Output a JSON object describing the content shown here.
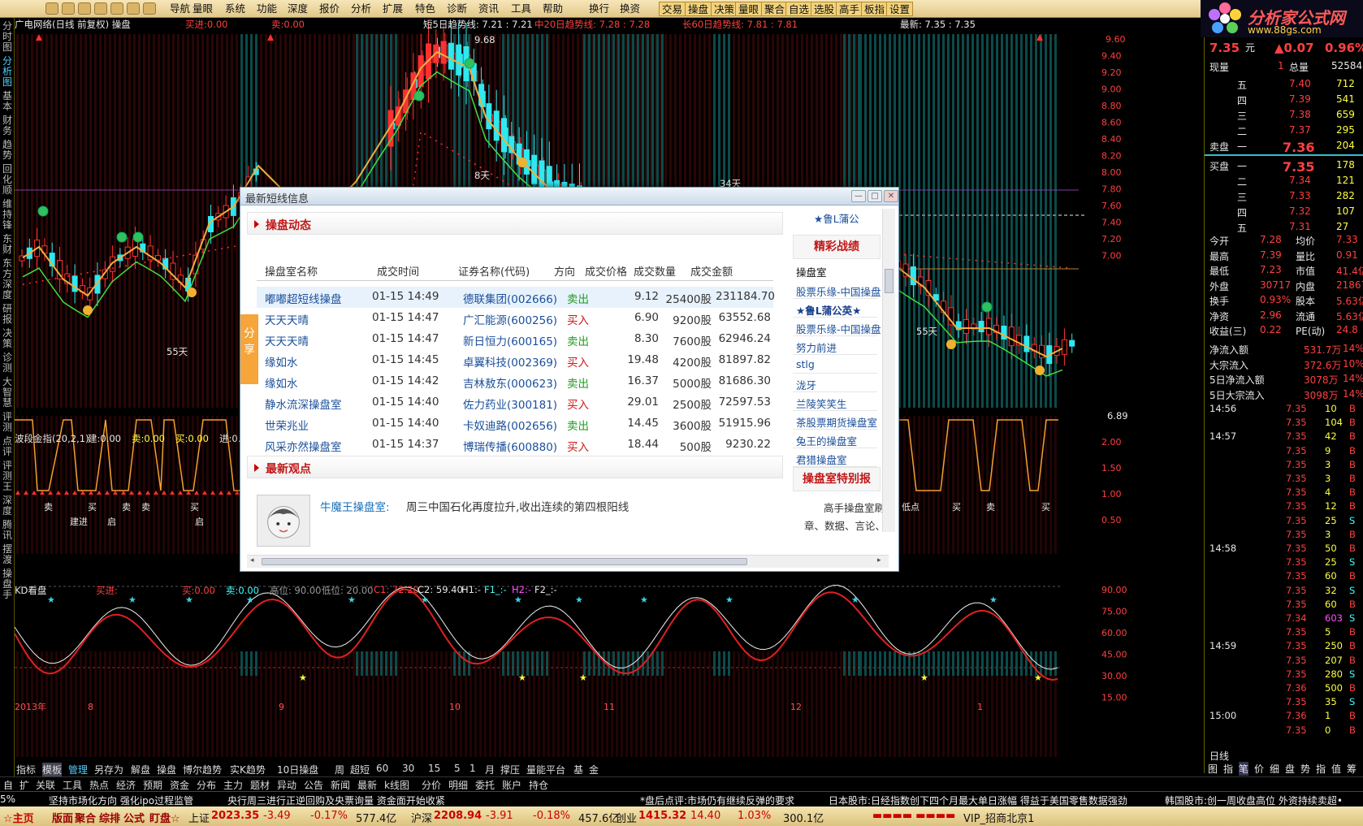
{
  "menu": [
    "导航",
    "量眼",
    "系统",
    "功能",
    "深度",
    "报价",
    "分析",
    "扩展",
    "特色",
    "诊断",
    "资讯",
    "工具",
    "帮助",
    "换行",
    "换资",
    "交易",
    "操盘",
    "决策",
    "量眼",
    "聚合",
    "自选",
    "选股",
    "高手",
    "板指",
    "设置"
  ],
  "logo": {
    "title": "分析家公式网",
    "url": "www.88gs.com"
  },
  "left_tabs": [
    "分时图",
    "分析图",
    "基本",
    "财务",
    "趋势",
    "回化顺",
    "维持锋",
    "东财",
    "东方深度",
    "研报",
    "决策",
    "诊测",
    "大智慧",
    "评测",
    "点评",
    "评测王",
    "深度",
    "腾讯",
    "摆渡",
    "操盘手"
  ],
  "chart_header": {
    "title": "广电网络(日线 前复权) 操盘",
    "buy": "买进:0.00",
    "sell": "卖:0.00",
    "ma5": "短5日趋势线: 7.21 : 7.21",
    "ma20": "中20日趋势线: 7.28 : 7.28",
    "ma60": "长60日趋势线: 7.81 : 7.81",
    "latest": "最新: 7.35 : 7.35"
  },
  "main_labels": {
    "peak": "9.68",
    "d8": "8天",
    "d34": "34天",
    "d55a": "55天",
    "d55b": "55天",
    "low": "6.89"
  },
  "price_axis": [
    "9.60",
    "9.40",
    "9.20",
    "9.00",
    "8.80",
    "8.60",
    "8.40",
    "8.20",
    "8.00",
    "7.80",
    "7.60",
    "7.40",
    "7.20",
    "7.00"
  ],
  "ind1_header": {
    "name": "波段金指(20,2,1)",
    "jian": "建:0.00",
    "mai": "卖:0.00",
    "buy": "买:0.00",
    "jin": "进:0."
  },
  "ind1_axis": [
    "2.00",
    "1.50",
    "1.00",
    "0.50"
  ],
  "ind1_labels": [
    {
      "t": "卖"
    },
    {
      "t": "建进"
    },
    {
      "t": "买"
    },
    {
      "t": "启"
    },
    {
      "t": "卖"
    },
    {
      "t": "卖"
    },
    {
      "t": "买"
    },
    {
      "t": "启"
    },
    {
      "t": "卖"
    },
    {
      "t": "低点"
    },
    {
      "t": "买"
    },
    {
      "t": "卖"
    },
    {
      "t": "买"
    }
  ],
  "ind2_header": {
    "name": "KD看盘",
    "mai": "买进:",
    "buy": "买:0.00",
    "sell": "卖:0.00",
    "gao": "高位: 90.00",
    "di": "低位: 20.00",
    "c1": "C1: 72.20",
    "c2": "C2: 59.40",
    "h1": "H1:-",
    "f1": "F1_:-",
    "h2": "H2:-",
    "f2": "F2_:-"
  },
  "ind2_axis": [
    "90.00",
    "75.00",
    "60.00",
    "45.00",
    "30.00",
    "15.00"
  ],
  "x_axis": [
    "2013年",
    "8",
    "9",
    "10",
    "11",
    "12",
    "1"
  ],
  "quote": {
    "price": "7.35",
    "unit": "元",
    "change": "▲0.07",
    "pct": "0.96%",
    "xianshou_l": "现量",
    "xianshou": "1",
    "zongliang_l": "总量",
    "zongliang": "52584",
    "sells": [
      [
        "五",
        "7.40",
        "712"
      ],
      [
        "四",
        "7.39",
        "541"
      ],
      [
        "三",
        "7.38",
        "659"
      ],
      [
        "二",
        "7.37",
        "295"
      ],
      [
        "一",
        "7.36",
        "204"
      ]
    ],
    "sell_label": "卖盘",
    "buy_label": "买盘",
    "buys": [
      [
        "一",
        "7.35",
        "178"
      ],
      [
        "二",
        "7.34",
        "121"
      ],
      [
        "三",
        "7.33",
        "282"
      ],
      [
        "四",
        "7.32",
        "107"
      ],
      [
        "五",
        "7.31",
        "27"
      ]
    ],
    "stats": [
      [
        "今开",
        "7.28",
        "均价",
        "7.33"
      ],
      [
        "最高",
        "7.39",
        "量比",
        "0.91"
      ],
      [
        "最低",
        "7.23",
        "市值",
        "41.4亿"
      ],
      [
        "外盘",
        "30717",
        "内盘",
        "21867"
      ],
      [
        "换手",
        "0.93%",
        "股本",
        "5.63亿"
      ],
      [
        "净资",
        "2.96",
        "流通",
        "5.63亿"
      ],
      [
        "收益(三)",
        "0.22",
        "PE(动)",
        "24.8"
      ]
    ],
    "flows": [
      [
        "净流入额",
        "531.7万",
        "14%"
      ],
      [
        "大宗流入",
        "372.6万",
        "10%"
      ],
      [
        "5日净流入额",
        "3078万",
        "14%"
      ],
      [
        "5日大宗流入",
        "3098万",
        "14%"
      ]
    ]
  },
  "ticks": [
    [
      "14:56",
      "7.35",
      "10",
      "B"
    ],
    [
      "",
      "7.35",
      "104",
      "B"
    ],
    [
      "14:57",
      "7.35",
      "42",
      "B"
    ],
    [
      "",
      "7.35",
      "9",
      "B"
    ],
    [
      "",
      "7.35",
      "3",
      "B"
    ],
    [
      "",
      "7.35",
      "3",
      "B"
    ],
    [
      "",
      "7.35",
      "4",
      "B"
    ],
    [
      "",
      "7.35",
      "12",
      "B"
    ],
    [
      "",
      "7.35",
      "25",
      "S"
    ],
    [
      "",
      "7.35",
      "3",
      "B"
    ],
    [
      "14:58",
      "7.35",
      "50",
      "B"
    ],
    [
      "",
      "7.35",
      "25",
      "S"
    ],
    [
      "",
      "7.35",
      "60",
      "B"
    ],
    [
      "",
      "7.35",
      "32",
      "S"
    ],
    [
      "",
      "7.35",
      "60",
      "B"
    ],
    [
      "",
      "7.34",
      "603",
      "S"
    ],
    [
      "",
      "7.35",
      "5",
      "B"
    ],
    [
      "14:59",
      "7.35",
      "250",
      "B"
    ],
    [
      "",
      "7.35",
      "207",
      "B"
    ],
    [
      "",
      "7.35",
      "280",
      "S"
    ],
    [
      "",
      "7.36",
      "500",
      "B"
    ],
    [
      "",
      "7.35",
      "35",
      "S"
    ],
    [
      "15:00",
      "7.36",
      "1",
      "B"
    ],
    [
      "",
      "7.35",
      "0",
      "B"
    ]
  ],
  "right_bottom": {
    "rixian": "日线",
    "tabs": [
      "图",
      "指",
      "笔",
      "价",
      "细",
      "盘",
      "势",
      "指",
      "值",
      "筹"
    ]
  },
  "bottom_tabs1": [
    "指标",
    "模板",
    "管理",
    "另存为",
    "解盘",
    "操盘",
    "博尔趋势",
    "实K趋势",
    "10日操盘",
    "周",
    "超短",
    "60",
    "30",
    "15",
    "5",
    "1",
    "月",
    "撑压",
    "量能平台",
    "基",
    "金"
  ],
  "bottom_tabs2": [
    "自",
    "扩",
    "关联",
    "工具",
    "热点",
    "经济",
    "预期",
    "资金",
    "分布",
    "主力",
    "题材",
    "异动",
    "公告",
    "新闻",
    "最新",
    "k线图",
    "分价",
    "明细",
    "委托",
    "账户",
    "持仓"
  ],
  "ticker": [
    "5%",
    "坚持市场化方向 强化ipo过程监管",
    "央行周三进行正逆回购及央票询量 资金面开始收紧",
    "*盘后点评:市场仍有继续反弹的要求",
    "日本股市:日经指数创下四个月最大单日涨幅 得益于美国零售数据强劲",
    "韩国股市:创一周收盘高位 外资持续卖超•"
  ],
  "status": {
    "home": "主页",
    "items": [
      "版面",
      "聚合",
      "综排",
      "公式",
      "盯盘☆"
    ],
    "sh_l": "上证",
    "sh": "2023.35",
    "sh_c": "-3.49",
    "sh_p": "-0.17%",
    "sh_v": "577.4亿",
    "hs_l": "沪深",
    "hs": "2208.94",
    "hs_c": "-3.91",
    "hs_p": "-0.18%",
    "hs_v": "457.6亿",
    "cy_l": "创业",
    "cy": "1415.32",
    "cy_c": "14.40",
    "cy_p": "1.03%",
    "cy_v": "300.1亿",
    "vip": "VIP_招商北京1"
  },
  "dialog": {
    "title": "最新短线信息",
    "section1": "操盘动态",
    "share": "分享",
    "headers": [
      "操盘室名称",
      "成交时间",
      "证券名称(代码)",
      "方向",
      "成交价格",
      "成交数量",
      "成交金额"
    ],
    "rows": [
      [
        "嘟嘟超短线操盘",
        "01-15 14:49",
        "德联集团(002666)",
        "卖出",
        "9.12",
        "25400股",
        "231184.70"
      ],
      [
        "天天天晴",
        "01-15 14:47",
        "广汇能源(600256)",
        "买入",
        "6.90",
        "9200股",
        "63552.68"
      ],
      [
        "天天天晴",
        "01-15 14:47",
        "新日恒力(600165)",
        "卖出",
        "8.30",
        "7600股",
        "62946.24"
      ],
      [
        "缘如水",
        "01-15 14:45",
        "卓翼科技(002369)",
        "买入",
        "19.48",
        "4200股",
        "81897.82"
      ],
      [
        "缘如水",
        "01-15 14:42",
        "吉林敖东(000623)",
        "卖出",
        "16.37",
        "5000股",
        "81686.30"
      ],
      [
        "静水流深操盘室",
        "01-15 14:40",
        "佐力药业(300181)",
        "买入",
        "29.01",
        "2500股",
        "72597.53"
      ],
      [
        "世荣兆业",
        "01-15 14:40",
        "卡奴迪路(002656)",
        "卖出",
        "14.45",
        "3600股",
        "51915.96"
      ],
      [
        "风采亦然操盘室",
        "01-15 14:37",
        "博瑞传播(600880)",
        "买入",
        "18.44",
        "500股",
        "9230.22"
      ]
    ],
    "section2": "最新观点",
    "view_author": "牛魔王操盘室:",
    "view_text": "周三中国石化再度拉升,收出连续的第四根阳线",
    "right_top": "★鲁L蒲公",
    "right_head": "精彩战绩",
    "right_sub": "操盘室",
    "right_items": [
      "股票乐缘-中国操盘",
      "★鲁L蒲公英★",
      "股票乐缘-中国操盘",
      "努力前进",
      "stlg",
      "泷牙",
      "兰陵笑笑生",
      "茶股票期货操盘室",
      "兔王的操盘室",
      "君猎操盘室"
    ],
    "right_head2": "操盘室特别报",
    "right_foot1": "高手操盘室刷",
    "right_foot2": "章、数据、言论、"
  }
}
